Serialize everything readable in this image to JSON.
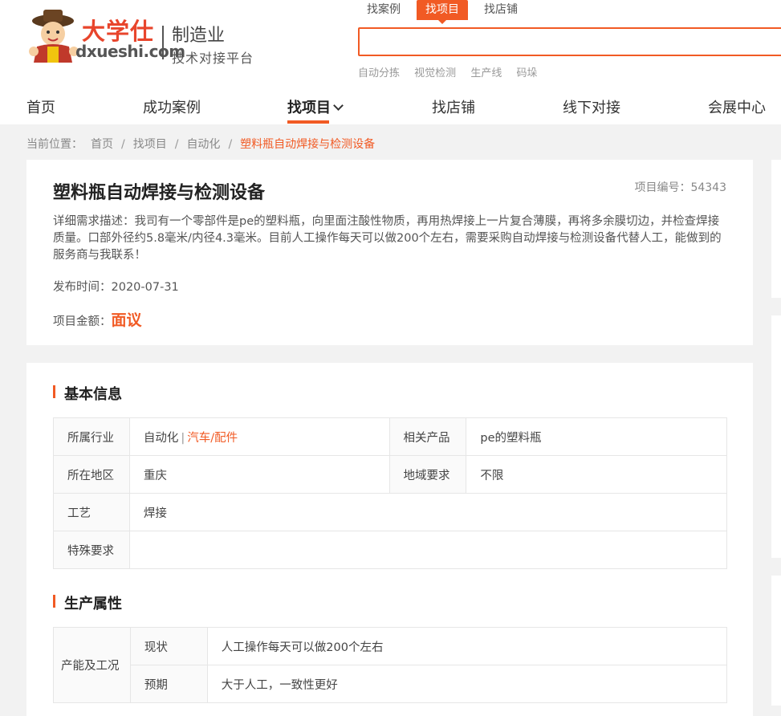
{
  "logo": {
    "brand_cn": "大学仕",
    "brand_en": "dxueshi.com",
    "industry": "制造业",
    "slogan": "技术对接平台"
  },
  "search": {
    "tabs": [
      "找案例",
      "找项目",
      "找店铺"
    ],
    "active_tab": "找项目",
    "value": "",
    "hot_words": [
      "自动分拣",
      "视觉检测",
      "生产线",
      "码垛"
    ]
  },
  "nav": {
    "items": [
      "首页",
      "成功案例",
      "找项目",
      "找店铺",
      "线下对接",
      "会展中心"
    ],
    "active": "找项目"
  },
  "breadcrumb": {
    "label": "当前位置：",
    "items": [
      "首页",
      "找项目",
      "自动化"
    ],
    "current": "塑料瓶自动焊接与检测设备"
  },
  "project": {
    "title": "塑料瓶自动焊接与检测设备",
    "number": "项目编号：54343",
    "desc_label": "详细需求描述：",
    "desc": "我司有一个零部件是pe的塑料瓶，向里面注酸性物质，再用热焊接上一片复合薄膜，再将多余膜切边，并检查焊接质量。口部外径约5.8毫米/内径4.3毫米。目前人工操作每天可以做200个左右，需要采购自动焊接与检测设备代替人工，能做到的服务商与我联系！",
    "publish": "发布时间：2020-07-31",
    "amount_label": "项目金额：",
    "amount": "面议"
  },
  "basic_info": {
    "title": "基本信息",
    "industry_label": "所属行业",
    "industry_a": "自动化",
    "industry_sep": "|",
    "industry_b": "汽车/配件",
    "product_label": "相关产品",
    "product": "pe的塑料瓶",
    "region_label": "所在地区",
    "region": "重庆",
    "region_req_label": "地域要求",
    "region_req": "不限",
    "craft_label": "工艺",
    "craft": "焊接",
    "special_label": "特殊要求",
    "special": ""
  },
  "production": {
    "title": "生产属性",
    "group_label": "产能及工况",
    "rows": [
      {
        "label": "现状",
        "value": "人工操作每天可以做200个左右"
      },
      {
        "label": "预期",
        "value": "大于人工，一致性更好"
      }
    ]
  },
  "colors": {
    "accent": "#f15a24",
    "background": "#f2f2f2"
  }
}
